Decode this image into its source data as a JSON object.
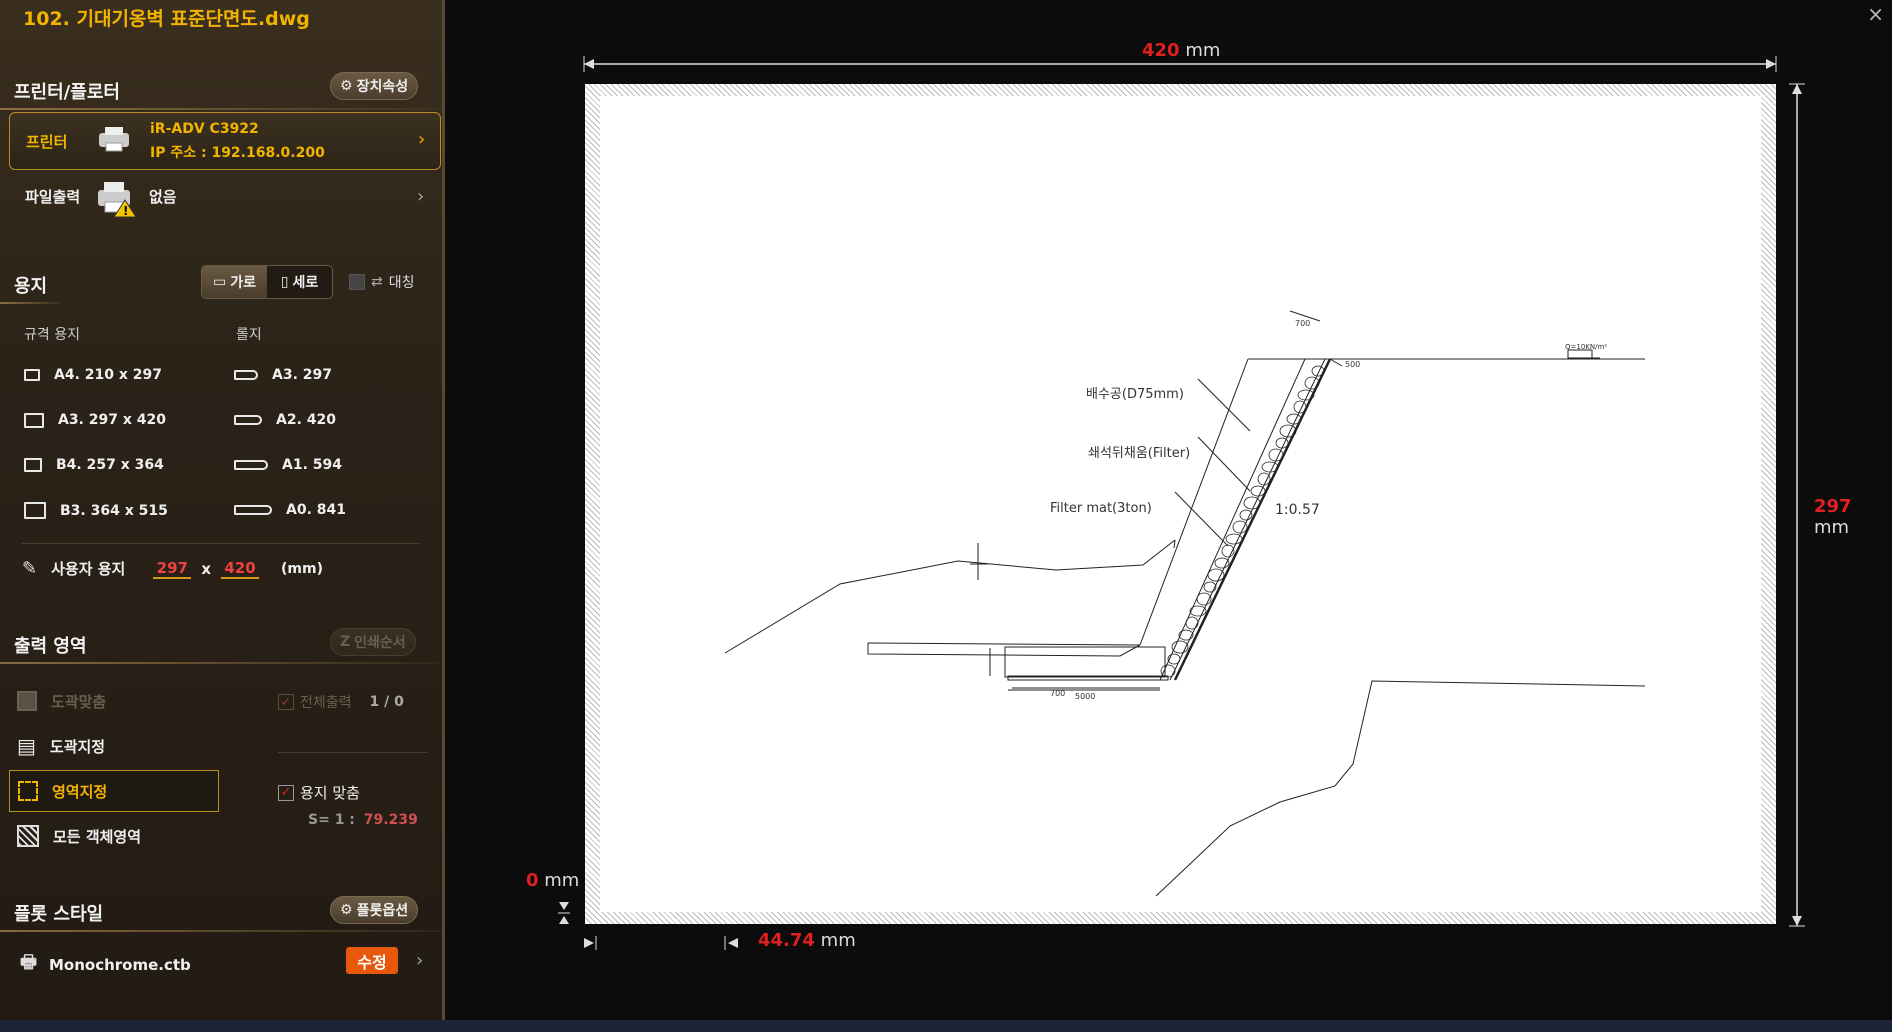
{
  "window": {
    "title": "102. 기대기옹벽 표준단면도.dwg",
    "close": "×"
  },
  "printer_section": {
    "heading": "프린터/플로터",
    "device_props_btn": "장치속성",
    "printer": {
      "label": "프린터",
      "name": "iR-ADV C3922",
      "ip": "IP 주소 : 192.168.0.200"
    },
    "file_output": {
      "label": "파일출력",
      "value": "없음"
    }
  },
  "paper_section": {
    "heading": "용지",
    "orientation": {
      "landscape": "가로",
      "portrait": "세로",
      "selected": "가로"
    },
    "mirror": "대칭",
    "std_header": "규격 용지",
    "roll_header": "롤지",
    "std_papers": [
      "A4. 210 x 297",
      "A3. 297 x 420",
      "B4. 257 x 364",
      "B3. 364 x 515"
    ],
    "roll_papers": [
      "A3. 297",
      "A2. 420",
      "A1. 594",
      "A0. 841"
    ],
    "custom": {
      "label": "사용자 용지",
      "width": "297",
      "x": "x",
      "height": "420",
      "unit": "(mm)"
    }
  },
  "output_section": {
    "heading": "출력 영역",
    "print_order_btn": "인쇄순서",
    "items": [
      "도곽맞춤",
      "도곽지정",
      "영역지정",
      "모든 객체영역"
    ],
    "selected": "영역지정",
    "print_all": {
      "label": "전체출력",
      "count": "1 / 0"
    },
    "fit_paper": {
      "label": "용지 맞춤",
      "checked": true
    },
    "scale": {
      "label": "S= 1 :",
      "value": "79.239"
    }
  },
  "plot_style": {
    "heading": "플롯 스타일",
    "options_btn": "플롯옵션",
    "ctb": "Monochrome.ctb",
    "edit_btn": "수정"
  },
  "preview": {
    "width_value": "420",
    "height_value": "297",
    "offset_y_value": "0",
    "offset_x_value": "44.74",
    "unit": "mm",
    "drawing_labels": {
      "drain": "배수공(D75mm)",
      "backfill": "쇄석뒤채움(Filter)",
      "filtermat": "Filter mat(3ton)",
      "slope": "1:0.57",
      "dim700_top": "700",
      "dim500": "500",
      "load": "Q=10KN/m²",
      "dim700_side": "700",
      "dim5000": "5000"
    }
  },
  "colors": {
    "accent": "#f2b400",
    "value_red": "#e02020",
    "edit_btn": "#e8580c"
  }
}
